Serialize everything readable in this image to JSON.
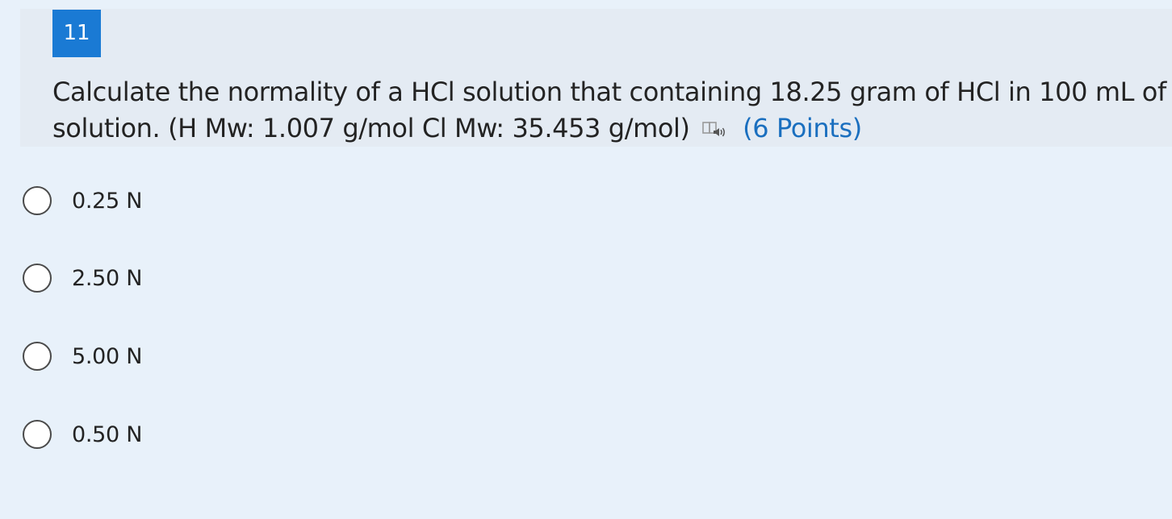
{
  "question": {
    "number": "11",
    "text": "Calculate the normality of a HCl solution that containing 18.25 gram of HCl in 100 mL of solution. (H Mw: 1.007 g/mol Cl Mw: 35.453 g/mol)",
    "points": "(6 Points)",
    "reader_icon": "immersive-reader-icon"
  },
  "options": [
    {
      "label": "0.25 N",
      "selected": false
    },
    {
      "label": "2.50 N",
      "selected": false
    },
    {
      "label": "5.00 N",
      "selected": false
    },
    {
      "label": "0.50 N",
      "selected": false
    }
  ],
  "colors": {
    "page_background": "#e8f1fa",
    "header_background": "#e4ebf3",
    "number_badge": "#1a7ad4",
    "points_text": "#1a6fbf",
    "text": "#232323"
  }
}
